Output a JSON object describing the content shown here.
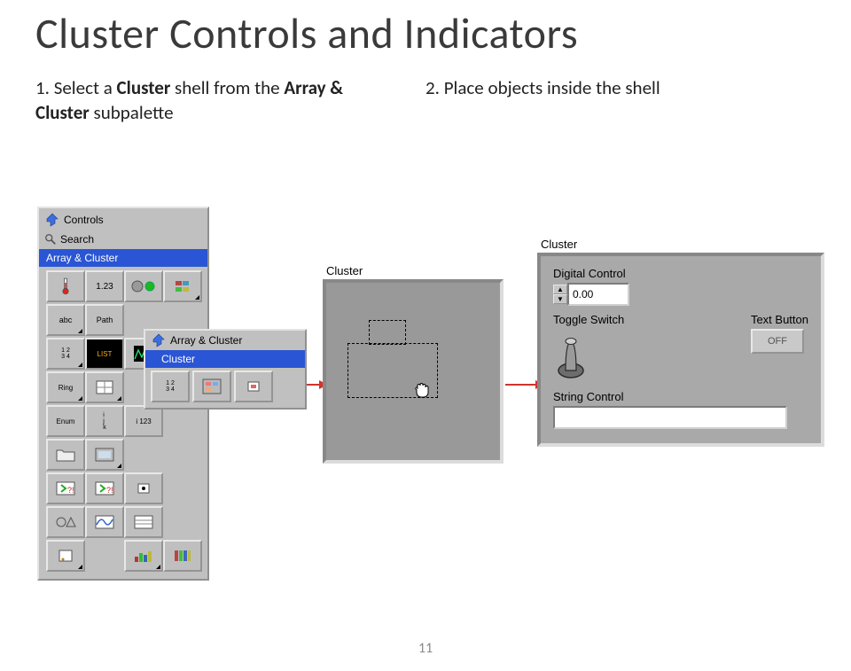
{
  "title": "Cluster Controls and Indicators",
  "steps": {
    "one": {
      "num": "1.",
      "pre": "Select a ",
      "b1": "Cluster",
      "mid": " shell from the ",
      "b2": "Array & Cluster",
      "post": " subpalette"
    },
    "two": {
      "num": "2.",
      "text": "Place objects inside the shell"
    }
  },
  "palette": {
    "controls_label": "Controls",
    "search_label": "Search",
    "category": "Array & Cluster",
    "item_123": "1.23",
    "item_abc": "abc",
    "item_path": "Path",
    "item_12_34": "1 2\n3 4",
    "item_list": "LIST",
    "item_ring": "Ring",
    "item_enum": "Enum",
    "item_ijk": "i\nj\nk",
    "item_i123": "i 123"
  },
  "submenu": {
    "title": "Array & Cluster",
    "selected": "Cluster"
  },
  "cluster_shell": {
    "label": "Cluster"
  },
  "cluster_pop": {
    "label": "Cluster",
    "digital_label": "Digital Control",
    "digital_value": "0.00",
    "toggle_label": "Toggle Switch",
    "text_button_label": "Text Button",
    "text_button_value": "OFF",
    "string_label": "String Control",
    "string_value": ""
  },
  "page_number": "11"
}
